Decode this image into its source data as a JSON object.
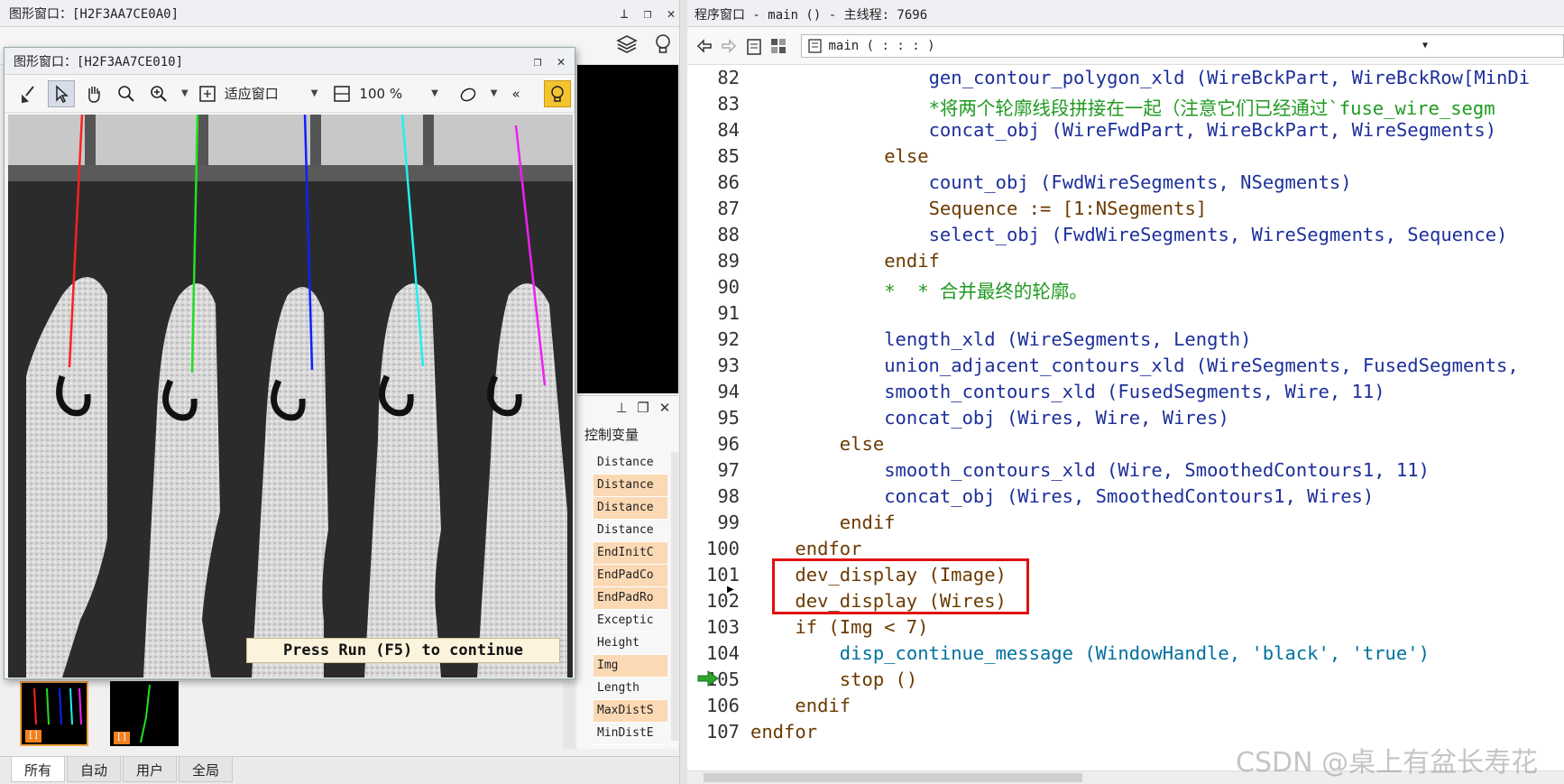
{
  "bg_graphics_window": {
    "title": "图形窗口：[H2F3AA7CE0A0]"
  },
  "float_graphics_window": {
    "title": "图形窗口：[H2F3AA7CE010]",
    "fit_label": "适应窗口",
    "zoom_label": "100 %",
    "continue_message": "Press Run (F5) to continue"
  },
  "variable_panel": {
    "title": "控制变量",
    "items": [
      {
        "name": "Distance",
        "highlight": false
      },
      {
        "name": "Distance",
        "highlight": true
      },
      {
        "name": "Distance",
        "highlight": true
      },
      {
        "name": "Distance",
        "highlight": false
      },
      {
        "name": "EndInitC",
        "highlight": true
      },
      {
        "name": "EndPadCo",
        "highlight": true
      },
      {
        "name": "EndPadRo",
        "highlight": true
      },
      {
        "name": "Exceptic",
        "highlight": false
      },
      {
        "name": "Height",
        "highlight": false
      },
      {
        "name": "Img",
        "highlight": true
      },
      {
        "name": "Length",
        "highlight": false
      },
      {
        "name": "MaxDistS",
        "highlight": true
      },
      {
        "name": "MinDistE",
        "highlight": false
      }
    ]
  },
  "bottom_tabs": [
    "所有",
    "自动",
    "用户",
    "全局"
  ],
  "thumbnail_badges": [
    "[]",
    "[]"
  ],
  "program_window": {
    "title": "程序窗口 - main () - 主线程: 7696",
    "procedure": "main ( : : : )"
  },
  "code_lines": [
    {
      "n": "82",
      "indent": 8,
      "type": "op",
      "text": "gen_contour_polygon_xld (WireBckPart, WireBckRow[MinDi"
    },
    {
      "n": "83",
      "indent": 8,
      "type": "cmt",
      "text": "*将两个轮廓线段拼接在一起（注意它们已经通过`fuse_wire_segm"
    },
    {
      "n": "84",
      "indent": 8,
      "type": "op",
      "text": "concat_obj (WireFwdPart, WireBckPart, WireSegments)"
    },
    {
      "n": "85",
      "indent": 6,
      "type": "ctl",
      "text": "else"
    },
    {
      "n": "86",
      "indent": 8,
      "type": "op",
      "text": "count_obj (FwdWireSegments, NSegments)"
    },
    {
      "n": "87",
      "indent": 8,
      "type": "ctl",
      "text": "Sequence := [1:NSegments]"
    },
    {
      "n": "88",
      "indent": 8,
      "type": "op",
      "text": "select_obj (FwdWireSegments, WireSegments, Sequence)"
    },
    {
      "n": "89",
      "indent": 6,
      "type": "ctl",
      "text": "endif"
    },
    {
      "n": "90",
      "indent": 6,
      "type": "cmt",
      "text": "*  * 合并最终的轮廓。"
    },
    {
      "n": "91",
      "indent": 0,
      "type": "op",
      "text": ""
    },
    {
      "n": "92",
      "indent": 6,
      "type": "op",
      "text": "length_xld (WireSegments, Length)"
    },
    {
      "n": "93",
      "indent": 6,
      "type": "op",
      "text": "union_adjacent_contours_xld (WireSegments, FusedSegments, "
    },
    {
      "n": "94",
      "indent": 6,
      "type": "op",
      "text": "smooth_contours_xld (FusedSegments, Wire, 11)"
    },
    {
      "n": "95",
      "indent": 6,
      "type": "op",
      "text": "concat_obj (Wires, Wire, Wires)"
    },
    {
      "n": "96",
      "indent": 4,
      "type": "ctl",
      "text": "else"
    },
    {
      "n": "97",
      "indent": 6,
      "type": "op",
      "text": "smooth_contours_xld (Wire, SmoothedContours1, 11)"
    },
    {
      "n": "98",
      "indent": 6,
      "type": "op",
      "text": "concat_obj (Wires, SmoothedContours1, Wires)"
    },
    {
      "n": "99",
      "indent": 4,
      "type": "ctl",
      "text": "endif"
    },
    {
      "n": "100",
      "indent": 2,
      "type": "ctl",
      "text": "endfor"
    },
    {
      "n": "101",
      "indent": 2,
      "type": "dd",
      "text": "dev_display (Image)"
    },
    {
      "n": "102",
      "indent": 2,
      "type": "dd",
      "text": "dev_display (Wires)"
    },
    {
      "n": "103",
      "indent": 2,
      "type": "ctl",
      "text": "if (Img < 7)"
    },
    {
      "n": "104",
      "indent": 4,
      "type": "proc",
      "text": "disp_continue_message (WindowHandle, 'black', 'true')"
    },
    {
      "n": "105",
      "indent": 4,
      "type": "ctl",
      "text": "stop ()"
    },
    {
      "n": "106",
      "indent": 2,
      "type": "ctl",
      "text": "endif"
    },
    {
      "n": "107",
      "indent": 0,
      "type": "ctl",
      "text": "endfor"
    }
  ],
  "watermark": "CSDN @桌上有盆长寿花",
  "colors": {
    "wire1": "#ff2020",
    "wire2": "#20e020",
    "wire3": "#1020ff",
    "wire4": "#20f0f0",
    "wire5": "#f020f0",
    "highlight_box": "#e01010",
    "var_highlight": "#fbd9b4"
  }
}
